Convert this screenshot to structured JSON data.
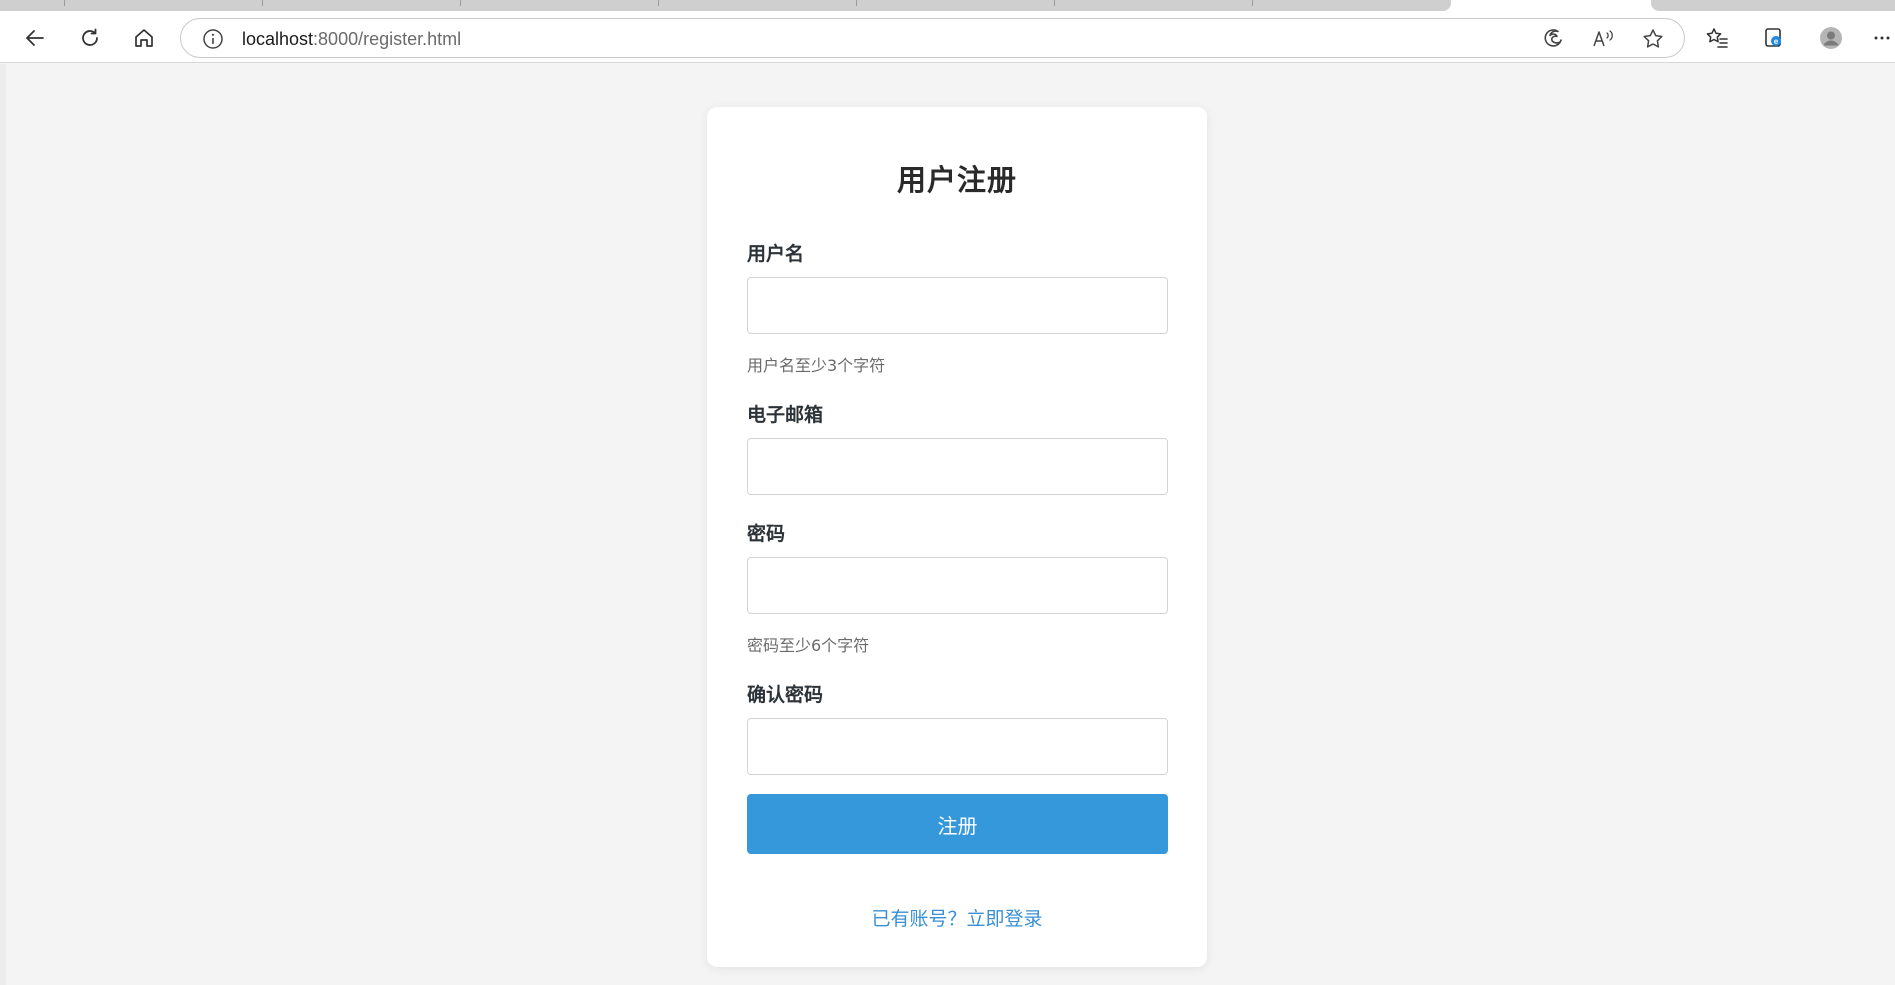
{
  "browser": {
    "url_host": "localhost",
    "url_path": ":8000/register.html"
  },
  "form": {
    "title": "用户注册",
    "fields": [
      {
        "label": "用户名",
        "value": "",
        "placeholder": "",
        "hint": "用户名至少3个字符"
      },
      {
        "label": "电子邮箱",
        "value": "",
        "placeholder": "",
        "hint": ""
      },
      {
        "label": "密码",
        "value": "",
        "placeholder": "",
        "hint": "密码至少6个字符"
      },
      {
        "label": "确认密码",
        "value": "",
        "placeholder": "",
        "hint": ""
      }
    ],
    "submit_label": "注册",
    "login_link": "已有账号？立即登录"
  },
  "colors": {
    "accent": "#3498db",
    "link": "#3a8fd4",
    "page_background": "#f4f4f4"
  },
  "icons": [
    "back-icon",
    "refresh-icon",
    "home-icon",
    "info-icon",
    "edge-icon",
    "read-aloud-icon",
    "favorite-star-icon",
    "favorites-icon",
    "collections-icon",
    "profile-icon",
    "more-icon"
  ]
}
